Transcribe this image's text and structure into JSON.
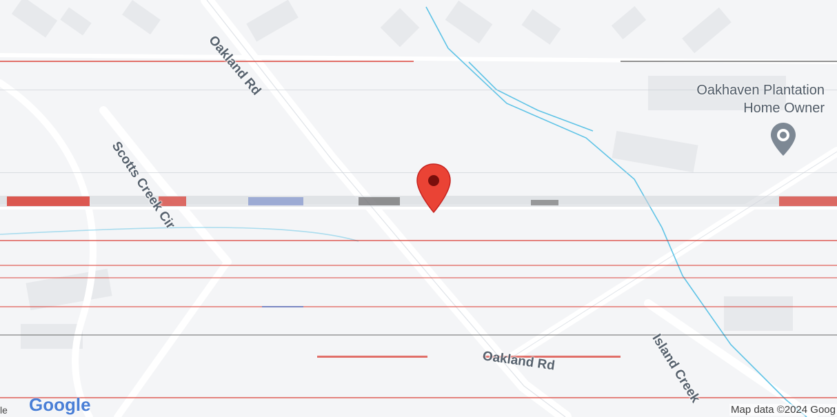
{
  "map": {
    "roads": {
      "oakland_rd": "Oakland Rd",
      "scotts_creek": "Scotts Creek Cir",
      "lower_road": "Oakland Rd",
      "island": "Island Creek"
    },
    "poi": {
      "line1": "Oakhaven Plantation",
      "line2": "Home Owner"
    },
    "colors": {
      "background": "#f4f5f7",
      "water": "#5ec3e6",
      "pin": "#ea4335",
      "road": "#ffffff"
    }
  },
  "footer": {
    "left_fragment": "le",
    "logo": "Google",
    "attribution": "Map data ©2024 Goog"
  }
}
